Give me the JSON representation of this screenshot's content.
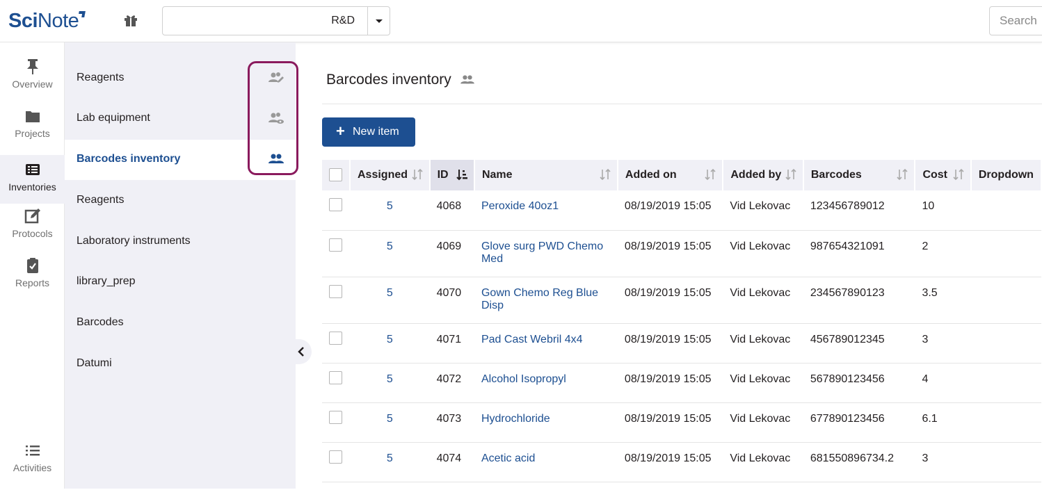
{
  "header": {
    "logo_sci": "Sci",
    "logo_note": "Note",
    "team": "R&D",
    "search_placeholder": "Search"
  },
  "leftnav": [
    {
      "label": "Overview",
      "icon": "pin-icon"
    },
    {
      "label": "Projects",
      "icon": "folder-icon"
    },
    {
      "label": "Inventories",
      "icon": "list-icon",
      "active": true
    },
    {
      "label": "Protocols",
      "icon": "edit-icon"
    },
    {
      "label": "Reports",
      "icon": "clipboard-icon"
    },
    {
      "label": "Activities",
      "icon": "activities-icon"
    }
  ],
  "inventories": [
    {
      "name": "Reagents",
      "share": "shared-edit-icon"
    },
    {
      "name": "Lab equipment",
      "share": "shared-view-icon"
    },
    {
      "name": "Barcodes inventory",
      "share": "shared-icon",
      "active": true
    },
    {
      "name": "Reagents"
    },
    {
      "name": "Laboratory instruments"
    },
    {
      "name": "library_prep"
    },
    {
      "name": "Barcodes"
    },
    {
      "name": "Datumi"
    }
  ],
  "main": {
    "title": "Barcodes inventory",
    "new_item": "New item"
  },
  "table": {
    "columns": [
      "Assigned",
      "ID",
      "Name",
      "Added on",
      "Added by",
      "Barcodes",
      "Cost",
      "Dropdown"
    ],
    "rows": [
      {
        "assigned": "5",
        "id": "4068",
        "name": "Peroxide 40oz1",
        "added_on": "08/19/2019 15:05",
        "added_by": "Vid Lekovac",
        "barcode": "123456789012",
        "cost": "10"
      },
      {
        "assigned": "5",
        "id": "4069",
        "name": "Glove surg PWD Chemo Med",
        "added_on": "08/19/2019 15:05",
        "added_by": "Vid Lekovac",
        "barcode": "987654321091",
        "cost": "2"
      },
      {
        "assigned": "5",
        "id": "4070",
        "name": "Gown Chemo Reg Blue Disp",
        "added_on": "08/19/2019 15:05",
        "added_by": "Vid Lekovac",
        "barcode": "234567890123",
        "cost": "3.5"
      },
      {
        "assigned": "5",
        "id": "4071",
        "name": "Pad Cast Webril 4x4",
        "added_on": "08/19/2019 15:05",
        "added_by": "Vid Lekovac",
        "barcode": "456789012345",
        "cost": "3"
      },
      {
        "assigned": "5",
        "id": "4072",
        "name": "Alcohol Isopropyl",
        "added_on": "08/19/2019 15:05",
        "added_by": "Vid Lekovac",
        "barcode": "567890123456",
        "cost": "4"
      },
      {
        "assigned": "5",
        "id": "4073",
        "name": "Hydrochloride",
        "added_on": "08/19/2019 15:05",
        "added_by": "Vid Lekovac",
        "barcode": "677890123456",
        "cost": "6.1"
      },
      {
        "assigned": "5",
        "id": "4074",
        "name": "Acetic acid",
        "added_on": "08/19/2019 15:05",
        "added_by": "Vid Lekovac",
        "barcode": "681550896734.2",
        "cost": "3"
      }
    ]
  },
  "colors": {
    "brand": "#1d4f91",
    "highlight": "#8a1a5d",
    "panel": "#f0f0f6"
  }
}
